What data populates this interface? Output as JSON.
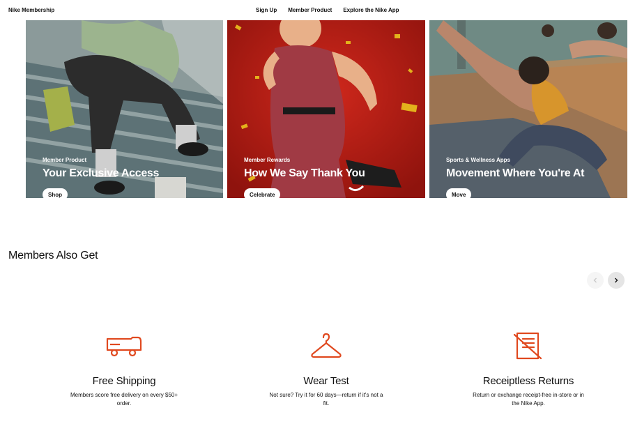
{
  "header": {
    "brand": "Nike Membership",
    "nav": [
      "Sign Up",
      "Member Product",
      "Explore the Nike App"
    ]
  },
  "cards": [
    {
      "eyebrow": "Member Product",
      "title": "Your Exclusive Access",
      "cta": "Shop"
    },
    {
      "eyebrow": "Member Rewards",
      "title": "How We Say Thank You",
      "cta": "Celebrate"
    },
    {
      "eyebrow": "Sports & Wellness Apps",
      "title": "Movement Where You're At",
      "cta": "Move"
    }
  ],
  "section": {
    "title": "Members Also Get"
  },
  "carousel": {
    "prev_icon": "chevron-left-icon",
    "next_icon": "chevron-right-icon"
  },
  "benefits": [
    {
      "icon": "delivery-truck-icon",
      "title": "Free Shipping",
      "desc": "Members score free delivery on every $50+ order."
    },
    {
      "icon": "hanger-icon",
      "title": "Wear Test",
      "desc": "Not sure? Try it for 60 days—return if it's not a fit."
    },
    {
      "icon": "receipt-crossed-icon",
      "title": "Receiptless Returns",
      "desc": "Return or exchange receipt-free in-store or in the Nike App."
    }
  ],
  "colors": {
    "accent": "#e0491f",
    "text": "#111111",
    "background": "#ffffff"
  }
}
